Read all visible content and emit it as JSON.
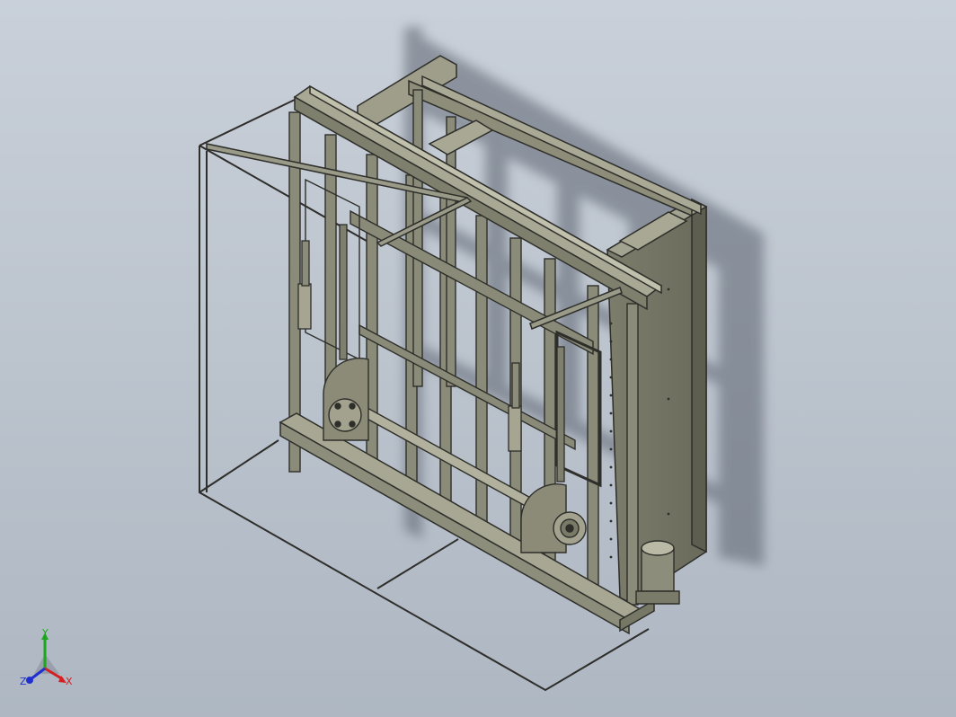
{
  "viewport": {
    "background_top": "#c9d0d9",
    "background_bottom": "#aeb7c2",
    "model_line_color": "#2e2e2a",
    "model_fill_color": "#8f8f7c",
    "model_fill_light": "#a9a996",
    "model_fill_dark": "#6f6f5e",
    "shadow_color": "#6e7784"
  },
  "triad": {
    "x_label": "X",
    "y_label": "Y",
    "z_label": "Z",
    "x_color": "#d42020",
    "y_color": "#1fa61f",
    "z_color": "#2030d0"
  }
}
